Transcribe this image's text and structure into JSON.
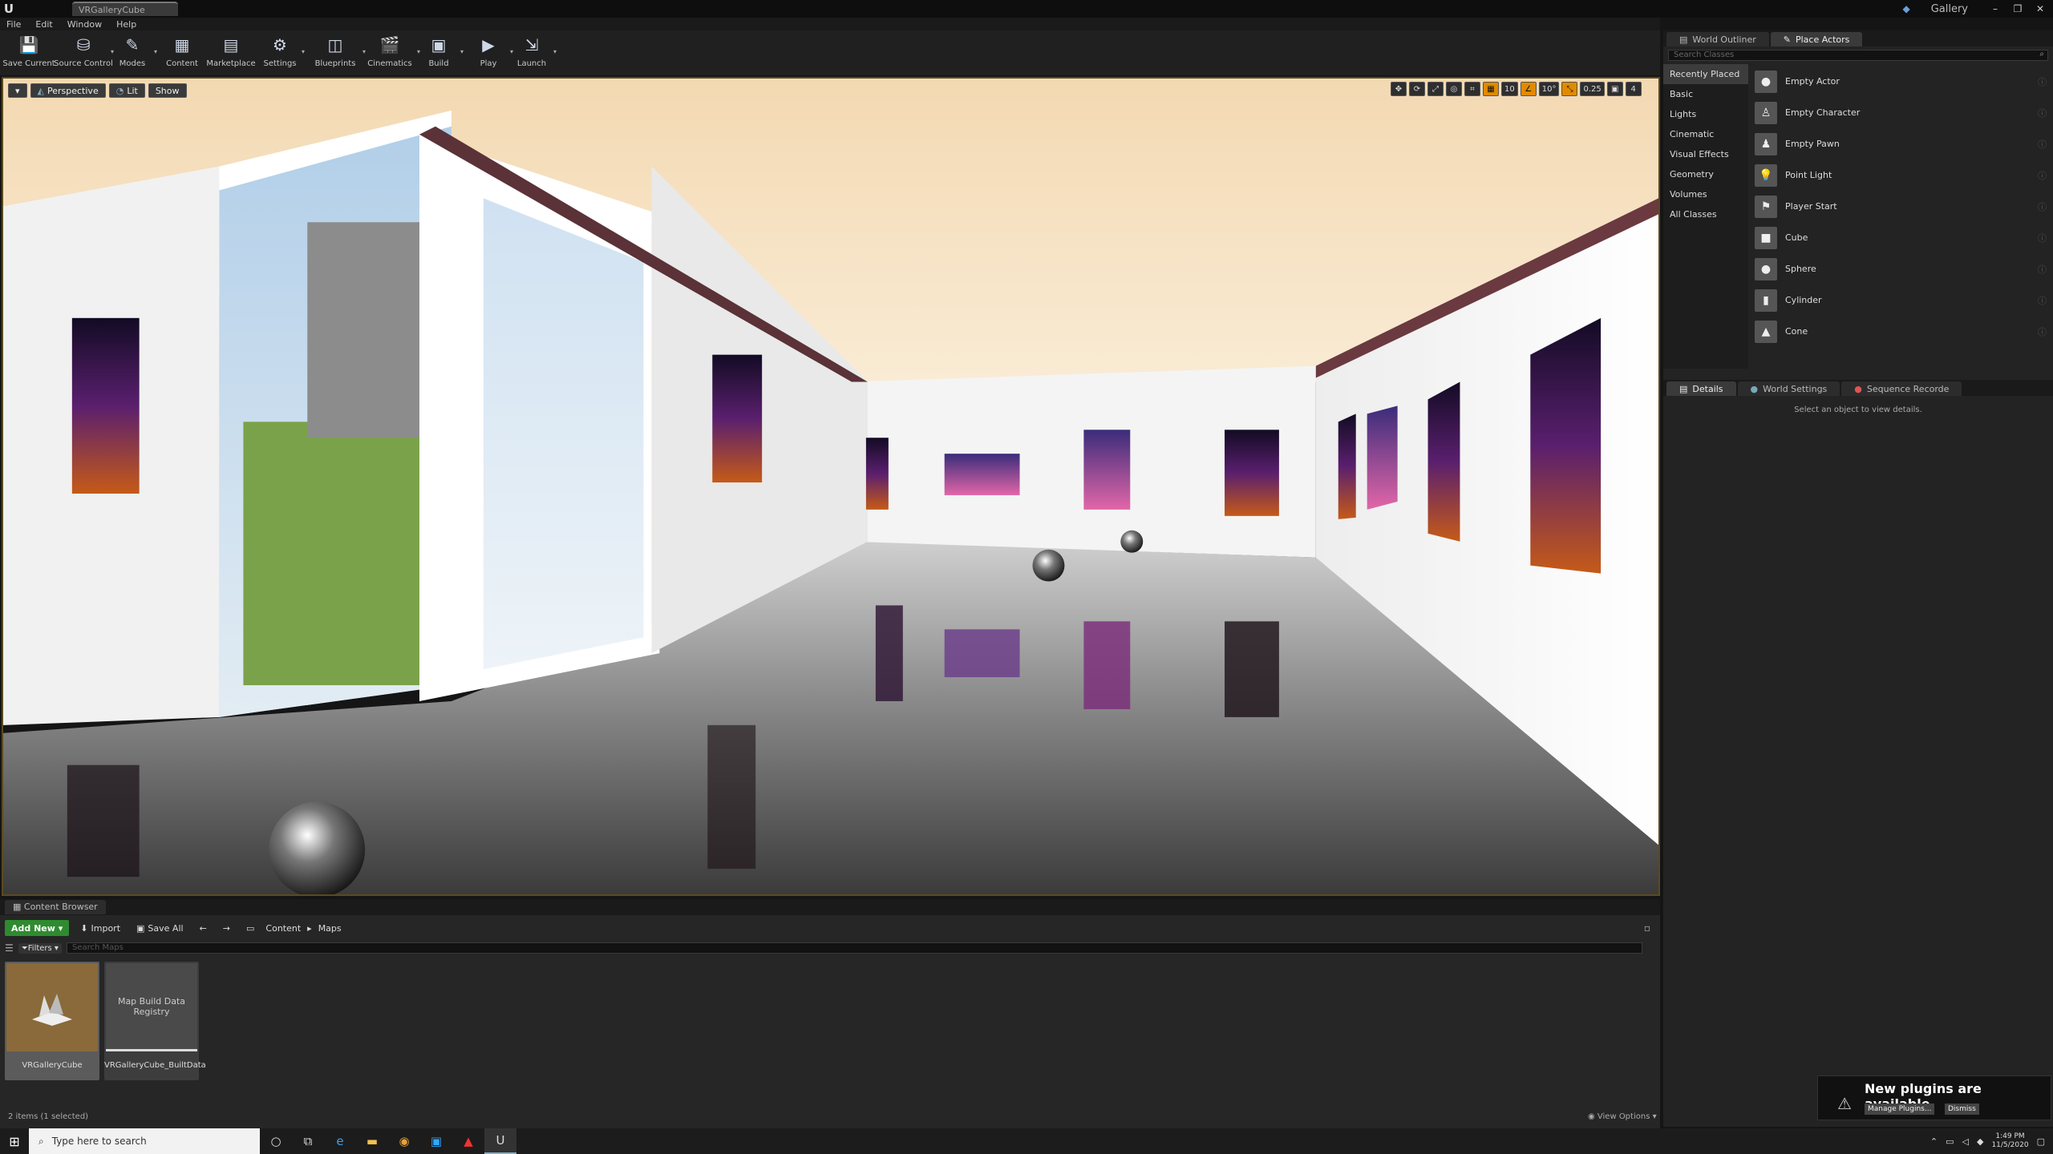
{
  "window": {
    "logo": "U",
    "doc_tab": "VRGalleryCube",
    "project": "Gallery",
    "controls": [
      "–",
      "❐",
      "✕"
    ]
  },
  "menu": [
    "File",
    "Edit",
    "Window",
    "Help"
  ],
  "toolbar": [
    {
      "label": "Save Current",
      "icon": "save-icon",
      "glyph": "💾",
      "caret": false
    },
    {
      "label": "Source Control",
      "icon": "source-control-icon",
      "glyph": "⛁",
      "caret": true
    },
    {
      "label": "Modes",
      "icon": "modes-icon",
      "glyph": "✎",
      "caret": true
    },
    {
      "label": "Content",
      "icon": "content-icon",
      "glyph": "▦",
      "caret": false
    },
    {
      "label": "Marketplace",
      "icon": "marketplace-icon",
      "glyph": "▤",
      "caret": false
    },
    {
      "label": "Settings",
      "icon": "settings-icon",
      "glyph": "⚙",
      "caret": true
    },
    {
      "label": "Blueprints",
      "icon": "blueprints-icon",
      "glyph": "◫",
      "caret": true
    },
    {
      "label": "Cinematics",
      "icon": "cinematics-icon",
      "glyph": "🎬",
      "caret": true
    },
    {
      "label": "Build",
      "icon": "build-icon",
      "glyph": "▣",
      "caret": true
    },
    {
      "label": "Play",
      "icon": "play-icon",
      "glyph": "▶",
      "caret": true
    },
    {
      "label": "Launch",
      "icon": "launch-icon",
      "glyph": "⇲",
      "caret": true
    }
  ],
  "viewport": {
    "perspective": "Perspective",
    "lit": "Lit",
    "show": "Show",
    "tools": [
      "✥",
      "⟳",
      "⤢",
      "◎",
      "⌗",
      "▦",
      "10",
      "∠",
      "10°",
      "⤡",
      "0.25",
      "▣",
      "4"
    ],
    "active_tools": [
      5,
      7,
      9
    ]
  },
  "right_panel": {
    "tabs": [
      "World Outliner",
      "Place Actors"
    ],
    "search_placeholder": "Search Classes",
    "categories": [
      "Recently Placed",
      "Basic",
      "Lights",
      "Cinematic",
      "Visual Effects",
      "Geometry",
      "Volumes",
      "All Classes"
    ],
    "active_category": 0,
    "actors": [
      {
        "name": "Empty Actor",
        "glyph": "●"
      },
      {
        "name": "Empty Character",
        "glyph": "♙"
      },
      {
        "name": "Empty Pawn",
        "glyph": "♟"
      },
      {
        "name": "Point Light",
        "glyph": "💡"
      },
      {
        "name": "Player Start",
        "glyph": "⚑"
      },
      {
        "name": "Cube",
        "glyph": "■"
      },
      {
        "name": "Sphere",
        "glyph": "●"
      },
      {
        "name": "Cylinder",
        "glyph": "▮"
      },
      {
        "name": "Cone",
        "glyph": "▲"
      }
    ],
    "details_tabs": [
      "Details",
      "World Settings",
      "Sequence Recorde"
    ],
    "details_empty": "Select an object to view details."
  },
  "content_browser": {
    "tab": "Content Browser",
    "add_new": "Add New",
    "import": "Import",
    "save_all": "Save All",
    "crumbs": [
      "Content",
      "Maps"
    ],
    "filters": "Filters",
    "search_placeholder": "Search Maps",
    "assets": [
      {
        "name": "VRGalleryCube",
        "thumb": "",
        "selected": true
      },
      {
        "name": "VRGalleryCube_BuiltData",
        "thumb": "Map Build Data Registry",
        "selected": false
      }
    ],
    "status": "2 items (1 selected)",
    "view_options": "View Options"
  },
  "notification": {
    "title": "New plugins are available",
    "manage": "Manage Plugins...",
    "dismiss": "Dismiss"
  },
  "taskbar": {
    "search_placeholder": "Type here to search",
    "time": "1:49 PM",
    "date": "11/5/2020"
  }
}
